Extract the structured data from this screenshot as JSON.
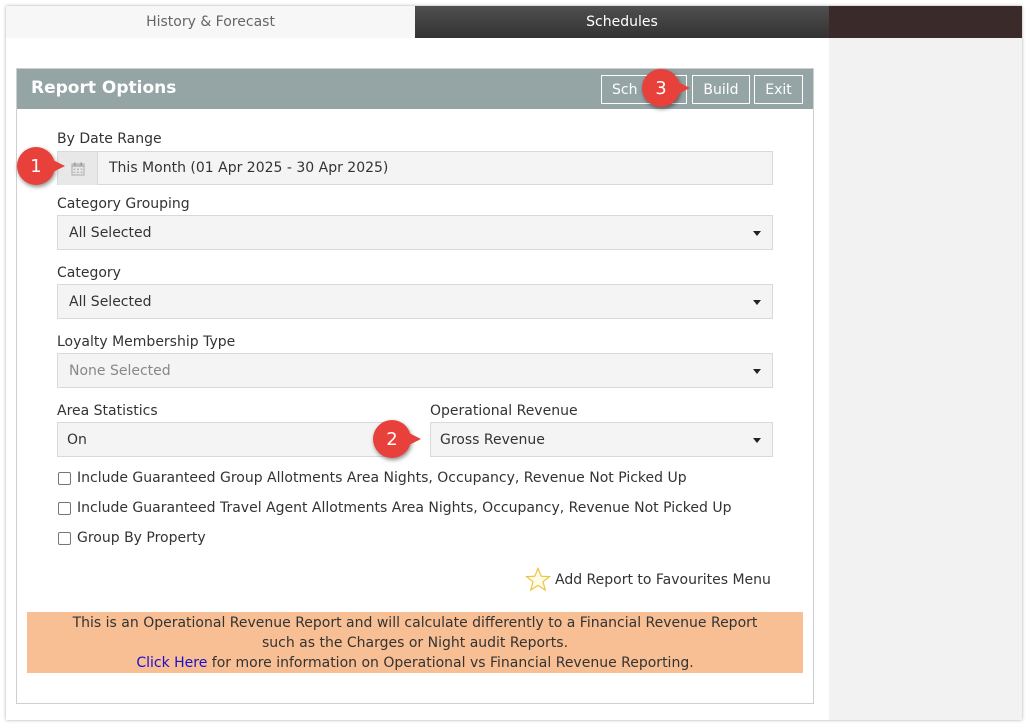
{
  "tabs": {
    "history": "History & Forecast",
    "schedules": "Schedules"
  },
  "panel": {
    "title": "Report Options",
    "buttons": {
      "schedule": "Sch",
      "build": "Build",
      "exit": "Exit"
    }
  },
  "date_range": {
    "label": "By Date Range",
    "value": "This Month (01 Apr 2025 - 30 Apr 2025)",
    "icon": "calendar-icon"
  },
  "category_grouping": {
    "label": "Category Grouping",
    "value": "All Selected"
  },
  "category": {
    "label": "Category",
    "value": "All Selected"
  },
  "loyalty": {
    "label": "Loyalty Membership Type",
    "value": "None Selected"
  },
  "area_statistics": {
    "label": "Area Statistics",
    "value": "On"
  },
  "operational_revenue": {
    "label": "Operational Revenue",
    "value": "Gross Revenue"
  },
  "checkboxes": [
    {
      "label": "Include Guaranteed Group Allotments Area Nights, Occupancy, Revenue Not Picked Up",
      "checked": false
    },
    {
      "label": "Include Guaranteed Travel Agent Allotments Area Nights, Occupancy, Revenue Not Picked Up",
      "checked": false
    },
    {
      "label": "Group By Property",
      "checked": false
    }
  ],
  "favourites": {
    "label": "Add Report to Favourites Menu",
    "icon": "star-icon"
  },
  "notice": {
    "line1": "This is an Operational Revenue Report and will calculate differently to a Financial Revenue Report",
    "line2": "such as the Charges or Night audit Reports.",
    "link": "Click Here",
    "line3_rest": " for more information on Operational vs Financial Revenue Reporting."
  },
  "markers": [
    "1",
    "2",
    "3"
  ],
  "colors": {
    "header": "#95a5a6",
    "notice_bg": "#f8bf94",
    "marker": "#e8403a",
    "link": "#1a0dcc"
  }
}
